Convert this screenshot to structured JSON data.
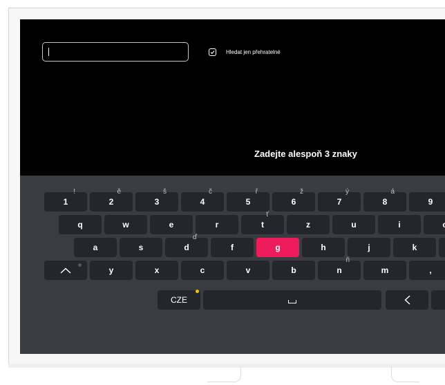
{
  "search": {
    "value": ""
  },
  "filter": {
    "label": "Hledat jen přehratelné",
    "checked": true
  },
  "hint": "Zadejte alespoň 3 znaky",
  "keyboard": {
    "numbers": [
      "1",
      "2",
      "3",
      "4",
      "5",
      "6",
      "7",
      "8",
      "9"
    ],
    "number_accents": [
      "!",
      "ě",
      "š",
      "č",
      "ř",
      "ž",
      "ý",
      "á",
      ""
    ],
    "row1": [
      "q",
      "w",
      "e",
      "r",
      "t",
      "z",
      "u",
      "i",
      "o"
    ],
    "row1_accents": [
      "",
      "",
      "",
      "",
      "ť",
      "",
      "",
      "",
      ""
    ],
    "row2": [
      "a",
      "s",
      "d",
      "f",
      "g",
      "h",
      "j",
      "k"
    ],
    "row2_accents": [
      "",
      "",
      "ď",
      "",
      "",
      "",
      "",
      ""
    ],
    "row3": [
      "y",
      "x",
      "c",
      "v",
      "b",
      "n",
      "m",
      ","
    ],
    "row3_accents": [
      "",
      "",
      "",
      "",
      "",
      "ň",
      "",
      "?"
    ],
    "language": "CZE",
    "selected_key": "g"
  },
  "colors": {
    "accent": "#ee1c5b",
    "indicator": "#f2c400",
    "key_bg": "#24262b",
    "keyboard_bg": "#3a3c42"
  },
  "icons": {
    "shift": "chevron-up-icon",
    "space": "space-bar-icon",
    "backspace": "chevron-left-icon",
    "checkbox": "checkmark-icon"
  }
}
